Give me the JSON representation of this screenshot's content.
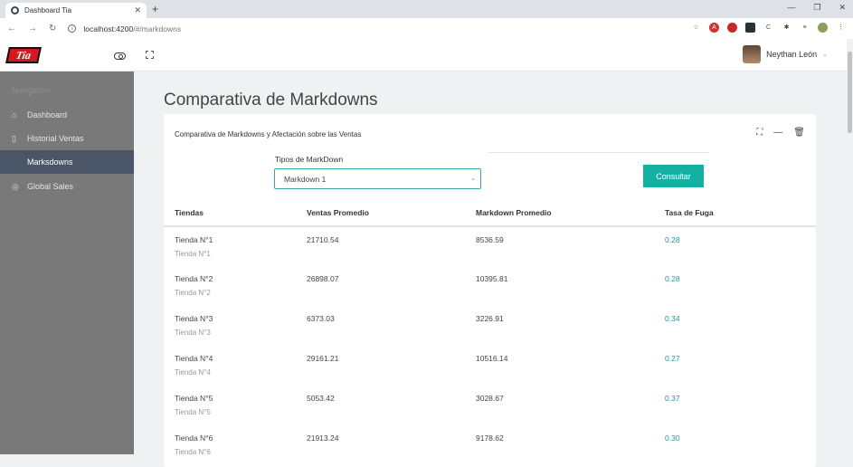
{
  "browser": {
    "tab_title": "Dashboard Tia",
    "url_host": "localhost:4200",
    "url_path": "/#/markdowns"
  },
  "topbar": {
    "logo_text": "Tia",
    "user_name": "Neythan León"
  },
  "sidebar": {
    "heading": "Navigation",
    "items": [
      {
        "label": "Dashboard",
        "icon": "home-icon"
      },
      {
        "label": "Historial Ventas",
        "icon": "list-icon"
      },
      {
        "label": "Marksdowns",
        "icon": "tag-icon"
      },
      {
        "label": "Global Sales",
        "icon": "globe-icon"
      }
    ]
  },
  "page": {
    "title": "Comparativa de Markdowns",
    "card_title": "Comparativa de Markdowns y Afectación sobre las Ventas",
    "select_label": "Tipos de MarkDown",
    "select_value": "Markdown 1",
    "button_label": "Consultar"
  },
  "table": {
    "headers": [
      "Tiendas",
      "Ventas Promedio",
      "Markdown Promedio",
      "Tasa de Fuga"
    ],
    "rows": [
      {
        "store": "Tienda N°1",
        "sub": "Tienda N°1",
        "sales": "21710.54",
        "markdown": "8536.59",
        "rate": "0.28"
      },
      {
        "store": "Tienda N°2",
        "sub": "Tienda N°2",
        "sales": "26898.07",
        "markdown": "10395.81",
        "rate": "0.28"
      },
      {
        "store": "Tienda N°3",
        "sub": "Tienda N°3",
        "sales": "6373.03",
        "markdown": "3226.91",
        "rate": "0.34"
      },
      {
        "store": "Tienda N°4",
        "sub": "Tienda N°4",
        "sales": "29161.21",
        "markdown": "10516.14",
        "rate": "0.27"
      },
      {
        "store": "Tienda N°5",
        "sub": "Tienda N°5",
        "sales": "5053.42",
        "markdown": "3028.67",
        "rate": "0.37"
      },
      {
        "store": "Tienda N°6",
        "sub": "Tienda N°6",
        "sales": "21913.24",
        "markdown": "9178.62",
        "rate": "0.30"
      }
    ]
  },
  "colors": {
    "accent": "#14b0a3",
    "sidebar_bg": "#797979",
    "sidebar_active": "#4a5568",
    "rate_text": "#1b9a9a"
  }
}
